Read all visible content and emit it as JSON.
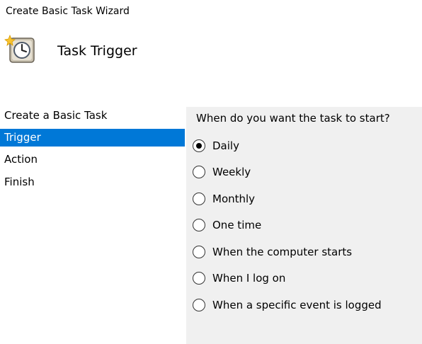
{
  "window": {
    "title": "Create Basic Task Wizard"
  },
  "header": {
    "icon": "clock-icon",
    "title": "Task Trigger"
  },
  "sidebar": {
    "items": [
      {
        "label": "Create a Basic Task",
        "selected": false
      },
      {
        "label": "Trigger",
        "selected": true
      },
      {
        "label": "Action",
        "selected": false
      },
      {
        "label": "Finish",
        "selected": false
      }
    ]
  },
  "main": {
    "question": "When do you want the task to start?",
    "options": [
      {
        "label": "Daily",
        "checked": true
      },
      {
        "label": "Weekly",
        "checked": false
      },
      {
        "label": "Monthly",
        "checked": false
      },
      {
        "label": "One time",
        "checked": false
      },
      {
        "label": "When the computer starts",
        "checked": false
      },
      {
        "label": "When I log on",
        "checked": false
      },
      {
        "label": "When a specific event is logged",
        "checked": false
      }
    ]
  },
  "colors": {
    "selection": "#0078d7",
    "panel_background": "#f0f0f0"
  }
}
